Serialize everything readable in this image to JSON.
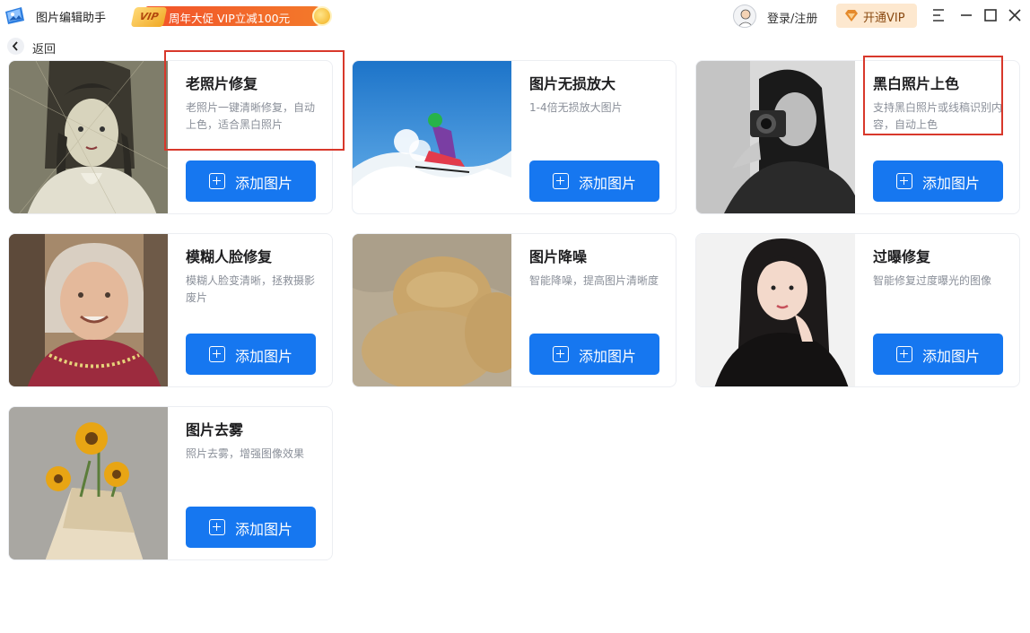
{
  "app": {
    "title": "图片编辑助手"
  },
  "promo": {
    "badge": "VIP",
    "text": "周年大促 VIP立减100元"
  },
  "header": {
    "login_label": "登录/注册",
    "vip_label": "开通VIP"
  },
  "nav": {
    "back_label": "返回"
  },
  "colors": {
    "primary": "#1677f0",
    "highlight": "#d8382b",
    "vip_bg": "#fde8cf"
  },
  "cards": [
    {
      "title": "老照片修复",
      "desc": "老照片一键清晰修复，自动上色，适合黑白照片",
      "button": "添加图片",
      "image": "old-photo-girl"
    },
    {
      "title": "图片无损放大",
      "desc": "1-4倍无损放大图片",
      "button": "添加图片",
      "image": "skier"
    },
    {
      "title": "黑白照片上色",
      "desc": "支持黑白照片或线稿识别内容，自动上色",
      "button": "添加图片",
      "image": "bw-photographer"
    },
    {
      "title": "模糊人脸修复",
      "desc": "模糊人脸变清晰，拯救摄影废片",
      "button": "添加图片",
      "image": "old-woman"
    },
    {
      "title": "图片降噪",
      "desc": "智能降噪，提高图片清晰度",
      "button": "添加图片",
      "image": "noisy-bread"
    },
    {
      "title": "过曝修复",
      "desc": "智能修复过度曝光的图像",
      "button": "添加图片",
      "image": "woman-portrait"
    },
    {
      "title": "图片去雾",
      "desc": "照片去雾，增强图像效果",
      "button": "添加图片",
      "image": "sunflowers"
    }
  ]
}
